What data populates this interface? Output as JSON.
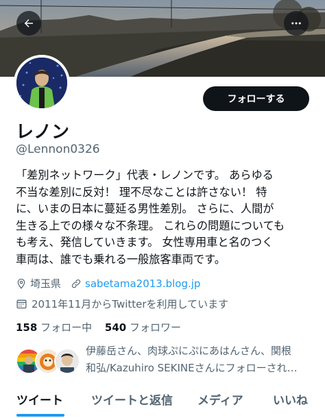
{
  "header": {
    "back_icon": "arrow-left-icon",
    "more_icon": "more-horizontal-icon"
  },
  "profile": {
    "follow_label": "フォローする",
    "display_name": "レノン",
    "handle": "@Lennon0326",
    "bio_lines": [
      "「差別ネットワーク」代表・レノンです。 あらゆる",
      "不当な差別に反対！ 理不尽なことは許さない！ 特",
      "に、いまの日本に蔓延る男性差別。 さらに、人間が",
      "生きる上での様々な不条理。 これらの問題についても",
      "も考え、発信していきます。 女性専用車と名のつく",
      "車両は、誰でも乗れる一般旅客車両です。"
    ],
    "location": "埼玉県",
    "website": "sabetama2013.blog.jp",
    "joined": "2011年11月からTwitterを利用しています",
    "following_count": "158",
    "following_label": "フォロー中",
    "followers_count": "540",
    "followers_label": "フォロワー",
    "followed_by_lines": [
      "伊藤岳さん、肉球ぷにぷにあはんさん、関根",
      "和弘/Kazuhiro SEKINEさんにフォローされ…"
    ]
  },
  "tabs": [
    {
      "label": "ツイート",
      "active": true
    },
    {
      "label": "ツイートと返信",
      "active": false
    },
    {
      "label": "メディア",
      "active": false
    },
    {
      "label": "いいね",
      "active": false
    }
  ],
  "colors": {
    "accent": "#1d9bf0",
    "text_primary": "#0f1419",
    "text_secondary": "#536471",
    "button_bg": "#0f1419"
  }
}
